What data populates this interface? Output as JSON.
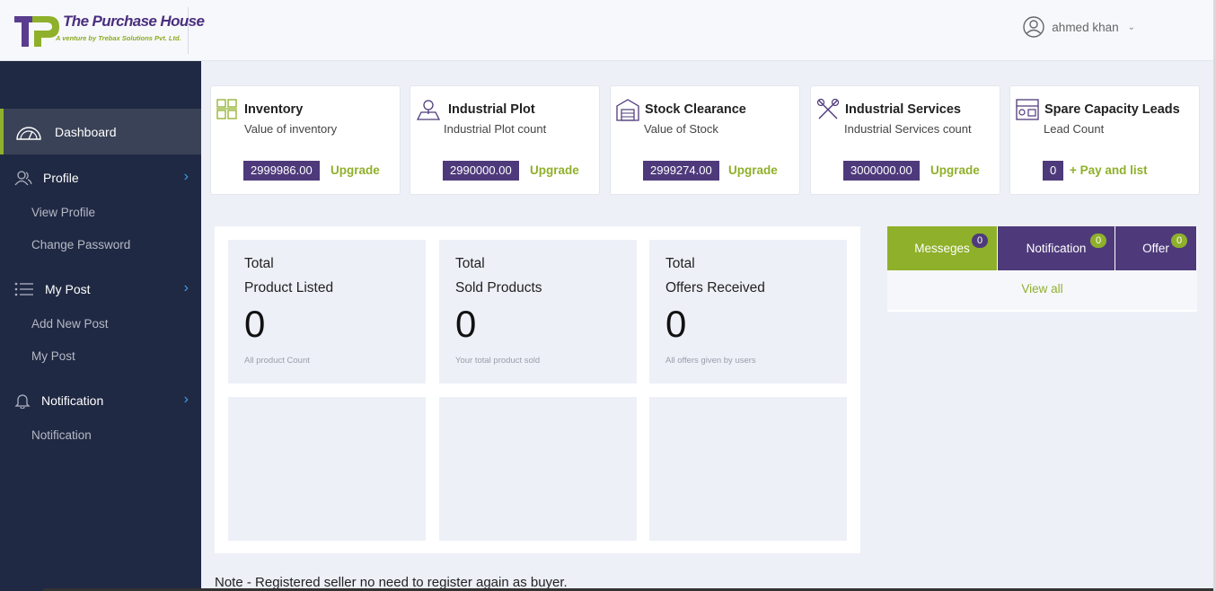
{
  "brand": {
    "title": "The Purchase House",
    "subtitle": "A venture by Trebax Solutions Pvt. Ltd."
  },
  "user": {
    "name": "ahmed khan"
  },
  "sidebar": {
    "dashboard": "Dashboard",
    "profile": {
      "label": "Profile",
      "items": [
        "View Profile",
        "Change Password"
      ]
    },
    "mypost": {
      "label": "My Post",
      "items": [
        "Add New Post",
        "My Post"
      ]
    },
    "notification": {
      "label": "Notification",
      "items": [
        "Notification"
      ]
    }
  },
  "cards": [
    {
      "title": "Inventory",
      "sub": "Value of inventory",
      "value": "2999986.00",
      "action": "Upgrade",
      "icon": "inventory-icon"
    },
    {
      "title": "Industrial Plot",
      "sub": "Industrial Plot count",
      "value": "2990000.00",
      "action": "Upgrade",
      "icon": "plot-icon"
    },
    {
      "title": "Stock Clearance",
      "sub": "Value of Stock",
      "value": "2999274.00",
      "action": "Upgrade",
      "icon": "warehouse-icon"
    },
    {
      "title": "Industrial Services",
      "sub": "Industrial Services count",
      "value": "3000000.00",
      "action": "Upgrade",
      "icon": "tools-icon"
    },
    {
      "title": "Spare Capacity Leads",
      "sub": "Lead Count",
      "value": "0",
      "action": "+ Pay and list",
      "icon": "factory-icon"
    }
  ],
  "stats": [
    {
      "line1": "Total",
      "line2": "Product Listed",
      "value": "0",
      "desc": "All product Count"
    },
    {
      "line1": "Total",
      "line2": "Sold Products",
      "value": "0",
      "desc": "Your total product sold"
    },
    {
      "line1": "Total",
      "line2": "Offers Received",
      "value": "0",
      "desc": "All offers given by users"
    }
  ],
  "tabs": {
    "messages": {
      "label": "Messeges",
      "count": "0"
    },
    "notification": {
      "label": "Notification",
      "count": "0"
    },
    "offer": {
      "label": "Offer",
      "count": "0"
    },
    "view_all": "View all"
  },
  "note": "Note - Registered seller no need to register again as buyer.",
  "colors": {
    "purple": "#4e3a7b",
    "green": "#8fb02a",
    "sidebar": "#202943"
  }
}
